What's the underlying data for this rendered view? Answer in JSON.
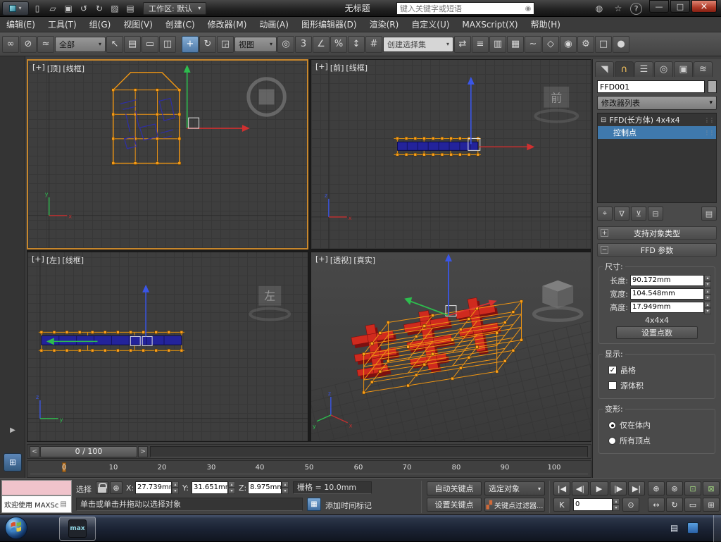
{
  "colors": {
    "active_viewport_border": "#c8872c",
    "selection_highlight": "#3f79ad",
    "lattice_orange": "#ffa21c",
    "object_red": "#cf2a1e",
    "move_tool_active": "#5c84ad"
  },
  "icons": {
    "app_arrow": "▾",
    "new_scene": "▯",
    "open_file": "▱",
    "save_file": "▣",
    "undo": "↺",
    "redo": "↻",
    "project_folder": "▨",
    "fetch": "▤",
    "dropdown_arrow": "▾",
    "search": "◉",
    "infocenter": "◍",
    "favorites": "☆",
    "help": "?",
    "minimize": "—",
    "maximize": "□",
    "close": "×",
    "select_link": "∞",
    "unlink": "⊘",
    "bind_spacewarp": "≈",
    "select_object": "↖",
    "select_by_name": "▤",
    "selection_region": "▭",
    "window_crossing": "◫",
    "select_move": "+",
    "select_rotate": "↻",
    "select_scale": "◲",
    "use_pivot": "◎",
    "snap_toggle": "3",
    "angle_snap": "∠",
    "percent_snap": "%",
    "spinner_snap": "↕",
    "kbd_override": "#",
    "mirror": "⇄",
    "align": "≡",
    "layer_manager": "▥",
    "ribbon": "▦",
    "curve_editor": "~",
    "schematic_view": "◇",
    "material_editor": "◉",
    "render_setup": "⚙",
    "rendered_frame": "□",
    "render_production": "●",
    "tab_create": "◥",
    "tab_modify": "∩",
    "tab_hierarchy": "☰",
    "tab_motion": "◎",
    "tab_display": "▣",
    "tab_utilities": "≋",
    "stack_expand": "⊟",
    "grip_dots": "⋮⋮",
    "pin_stack": "⌖",
    "show_end_result": "∇",
    "make_unique": "⊻",
    "remove_modifier": "⊟",
    "configure_sets": "▤",
    "rollout_plus": "+",
    "rollout_minus": "−",
    "check": "✓",
    "abs_mode": "⊕",
    "listener_menu": "▤",
    "time_tag_icon": "▦",
    "key_filters_icon": "▞",
    "slider_left": "<",
    "slider_right": ">",
    "goto_start": "|◀",
    "prev_frame": "◀|",
    "play": "▶",
    "next_frame": "|▶",
    "goto_end": "▶|",
    "key_mode": "K",
    "time_config": "⊙",
    "zoom": "⊕",
    "zoom_all": "⊚",
    "zoom_extents": "⊡",
    "zoom_extents_all": "⊠",
    "pan": "↔",
    "orbit": "↻",
    "zoom_region": "▭",
    "maximize_viewport": "⊞",
    "left_strip_arrow": "▶",
    "viewport_tabs": "⊞",
    "tray_indicator": "▤"
  },
  "titlebar": {
    "workspace": "工作区: 默认",
    "title": "无标题",
    "search_placeholder": "键入关键字或短语"
  },
  "menubar": {
    "items": [
      "编辑(E)",
      "工具(T)",
      "组(G)",
      "视图(V)",
      "创建(C)",
      "修改器(M)",
      "动画(A)",
      "图形编辑器(D)",
      "渲染(R)",
      "自定义(U)",
      "MAXScript(X)",
      "帮助(H)"
    ]
  },
  "toolbar": {
    "selection_filter": "全部",
    "reference_coordsys": "视图",
    "named_selection_sets": "创建选择集"
  },
  "viewports": {
    "top": {
      "menu": "[+]",
      "view": "[顶]",
      "shading": "[线框]"
    },
    "front": {
      "menu": "[+]",
      "view": "[前]",
      "shading": "[线框]",
      "ghost_label": "前"
    },
    "left": {
      "menu": "[+]",
      "view": "[左]",
      "shading": "[线框]",
      "ghost_label": "左"
    },
    "perspective": {
      "menu": "[+]",
      "view": "[透视]",
      "shading": "[真实]"
    }
  },
  "command_panel": {
    "object_name": "FFD001",
    "modifier_list_label": "修改器列表",
    "modifier_stack": [
      {
        "label": "FFD(长方体) 4x4x4"
      },
      {
        "label": "控制点"
      }
    ],
    "rollout_object_type": "支持对象类型",
    "rollout_ffd_params": "FFD 参数",
    "dimensions": {
      "group_title": "尺寸:",
      "length_label": "长度:",
      "length_value": "90.172mm",
      "width_label": "宽度:",
      "width_value": "104.548mm",
      "height_label": "高度:",
      "height_value": "17.949mm",
      "points_label": "4x4x4",
      "set_points_button": "设置点数"
    },
    "display": {
      "group_title": "显示:",
      "lattice": "晶格",
      "source_volume": "源体积"
    },
    "deform": {
      "group_title": "变形:",
      "only_in_volume": "仅在体内",
      "all_vertices": "所有顶点"
    }
  },
  "timeline": {
    "slider_label": "0 / 100",
    "ticks": [
      "0",
      "10",
      "20",
      "30",
      "40",
      "50",
      "60",
      "70",
      "80",
      "90",
      "100"
    ]
  },
  "status_bar": {
    "listener_text": "欢迎使用 MAXSc",
    "selection_label": "选择",
    "x_label": "X:",
    "x_value": "27.739mm",
    "y_label": "Y:",
    "y_value": "31.651mm",
    "z_label": "Z:",
    "z_value": "8.975mm",
    "grid_readout": "栅格 = 10.0mm",
    "prompt": "单击或单击并拖动以选择对象",
    "time_tag": "添加时间标记",
    "auto_key": "自动关键点",
    "set_key": "设置关键点",
    "selection_set": "选定对象",
    "key_filters": "关键点过滤器...",
    "frame_value": "0"
  }
}
